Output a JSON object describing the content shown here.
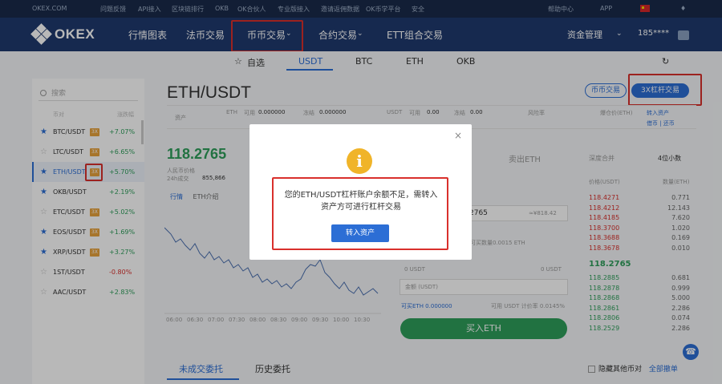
{
  "topbar": {
    "domain": "OKEX.COM",
    "links": [
      "问题反馈",
      "API接入",
      "区块链排行",
      "OKB",
      "OK合伙人",
      "专业版接入",
      "邀请返佣数据",
      "OK币学平台",
      "安全"
    ],
    "help": "帮助中心",
    "app": "APP"
  },
  "nav": {
    "logo": "OKEX",
    "items": [
      "行情图表",
      "法币交易",
      "币币交易",
      "合约交易",
      "ETT组合交易"
    ],
    "asset_mgmt": "资金管理",
    "account": "185****"
  },
  "market_tabs": [
    "自选",
    "USDT",
    "BTC",
    "ETH",
    "OKB"
  ],
  "sidebar": {
    "search_placeholder": "搜索",
    "col_pair": "币对",
    "col_change": "涨跌幅",
    "coins": [
      {
        "pair": "BTC/USDT",
        "lev": "3X",
        "change": "+7.07%",
        "starred": true
      },
      {
        "pair": "LTC/USDT",
        "lev": "3X",
        "change": "+6.65%",
        "starred": false
      },
      {
        "pair": "ETH/USDT",
        "lev": "3X",
        "change": "+5.70%",
        "starred": true,
        "active": true
      },
      {
        "pair": "OKB/USDT",
        "lev": "",
        "change": "+2.19%",
        "starred": true
      },
      {
        "pair": "ETC/USDT",
        "lev": "3X",
        "change": "+5.02%",
        "starred": false
      },
      {
        "pair": "EOS/USDT",
        "lev": "3X",
        "change": "+1.69%",
        "starred": true
      },
      {
        "pair": "XRP/USDT",
        "lev": "3X",
        "change": "+3.27%",
        "starred": true
      },
      {
        "pair": "1ST/USDT",
        "lev": "",
        "change": "-0.80%",
        "starred": false
      },
      {
        "pair": "AAC/USDT",
        "lev": "",
        "change": "+2.83%",
        "starred": false
      }
    ]
  },
  "main": {
    "pair_title": "ETH/USDT",
    "spot_btn": "币币交易",
    "margin_btn": "3X杠杆交易",
    "asset_label": "资产",
    "eth_label": "ETH",
    "usdt_label": "USDT",
    "avail_label": "可用",
    "frozen_label": "冻结",
    "eth_avail": "0.000000",
    "eth_frozen": "0.000000",
    "usdt_avail": "0.00",
    "usdt_frozen": "0.00",
    "risk_label": "风险率",
    "liq_label": "爆仓价(ETH)",
    "transfer_label": "转入资产",
    "borrow_label": "借币 | 还币",
    "price": "118.2765",
    "stat1_label": "人民币价格",
    "stat2_label": "24h成交",
    "stat2_value": "855,866",
    "chart_tab1": "行情",
    "chart_tab2": "ETH介绍",
    "times": [
      "06:00",
      "06:30",
      "07:00",
      "07:30",
      "08:00",
      "08:30",
      "09:00",
      "09:30",
      "10:00",
      "10:30"
    ]
  },
  "trade": {
    "sell_tab": "卖出ETH",
    "price_field": "2765",
    "cny_value": "≈¥818.42",
    "max_hint": "可买数量0.0015 ETH",
    "amount_usdt": "0 USDT",
    "amount_usdt2": "0 USDT",
    "total_label": "金额 (USDT)",
    "avail_eth": "可买ETH 0.000000",
    "avail_usdt": "可用 USDT 计价率 0.0145%",
    "buy_btn": "买入ETH"
  },
  "orderbook": {
    "merge_label": "深度合并",
    "depth_label": "4位小数",
    "col_price": "价格(USDT)",
    "col_amount": "数量(ETH)",
    "asks": [
      {
        "p": "118.4271",
        "a": "0.771"
      },
      {
        "p": "118.4212",
        "a": "12.143"
      },
      {
        "p": "118.4185",
        "a": "7.620"
      },
      {
        "p": "118.3700",
        "a": "1.020"
      },
      {
        "p": "118.3688",
        "a": "0.169"
      },
      {
        "p": "118.3678",
        "a": "0.010"
      }
    ],
    "last": "118.2765",
    "bids": [
      {
        "p": "118.2885",
        "a": "0.681"
      },
      {
        "p": "118.2878",
        "a": "0.999"
      },
      {
        "p": "118.2868",
        "a": "5.000"
      },
      {
        "p": "118.2861",
        "a": "2.286"
      },
      {
        "p": "118.2806",
        "a": "0.074"
      },
      {
        "p": "118.2529",
        "a": "2.286"
      }
    ]
  },
  "bottom": {
    "open_orders": "未成交委托",
    "history": "历史委托",
    "hide_other": "隐藏其他币对",
    "all_orders": "全部撤单"
  },
  "modal": {
    "message": "您的ETH/USDT杠杆账户余额不足，需转入资产方可进行杠杆交易",
    "button": "转入资产",
    "close": "×",
    "icon_glyph": "i"
  },
  "colors": {
    "nav_bg": "#1f3a6e",
    "accent": "#2c6ed5",
    "up": "#2e9e5b",
    "down": "#d9302c",
    "warning": "#f0b429",
    "annotation": "#d9302c"
  }
}
